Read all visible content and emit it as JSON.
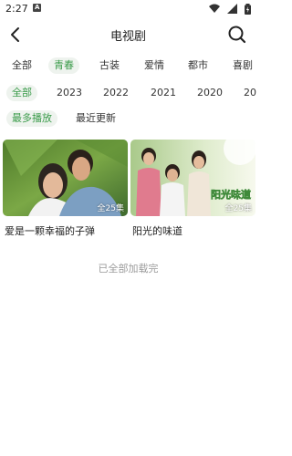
{
  "status": {
    "time": "2:27",
    "app_badge": "A"
  },
  "header": {
    "title": "电视剧"
  },
  "filters": {
    "genres": [
      "全部",
      "青春",
      "古装",
      "爱情",
      "都市",
      "喜剧"
    ],
    "years": [
      "全部",
      "2023",
      "2022",
      "2021",
      "2020",
      "20"
    ],
    "sorts": [
      "最多播放",
      "最近更新"
    ],
    "active_genre": "青春",
    "active_year": "全部",
    "active_sort": "最多播放"
  },
  "shows": [
    {
      "title": "爱是一颗幸福的子弹",
      "episodes": "全25集"
    },
    {
      "title": "阳光的味道",
      "episodes": "全25集",
      "poster_text": "阳光味道"
    }
  ],
  "footer": {
    "end_text": "已全部加载完"
  },
  "colors": {
    "accent": "#3a9b4a",
    "chip_bg": "#eef3ee",
    "muted": "#9a9a9a"
  }
}
